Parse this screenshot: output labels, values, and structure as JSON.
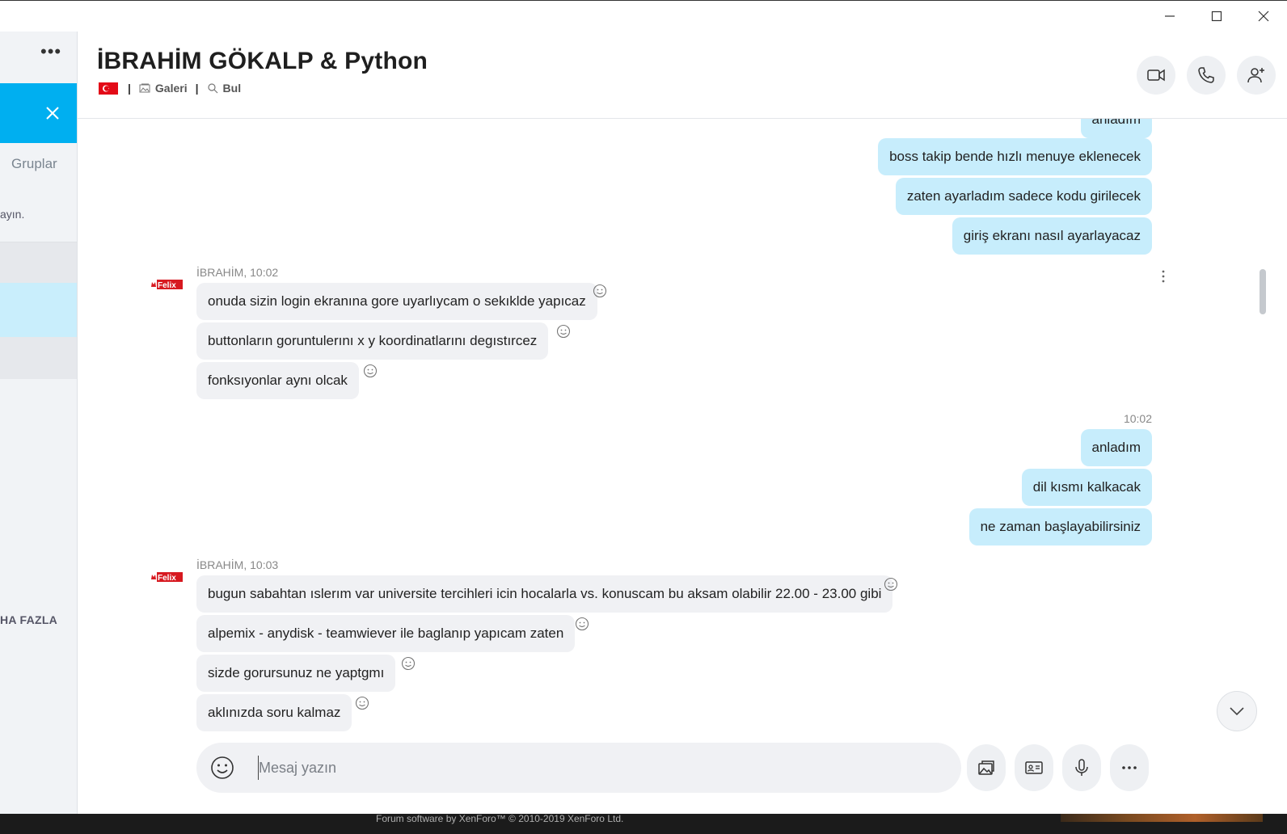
{
  "window": {
    "controls": [
      "minimize",
      "maximize",
      "close"
    ]
  },
  "sidebar": {
    "groups_tab": "Gruplar",
    "hint_fragment": "ayın.",
    "more_label": "HA FAZLA"
  },
  "header": {
    "title": "İBRAHİM GÖKALP & Python",
    "gallery_label": "Galeri",
    "find_label": "Bul",
    "separator": "|"
  },
  "messages": {
    "out_group_1": [
      "anladım",
      "boss takip bende hızlı menuye eklenecek",
      "zaten ayarladım sadece kodu girilecek",
      "giriş ekranı nasıl ayarlayacaz"
    ],
    "in_group_1": {
      "meta": "İBRAHİM, 10:02",
      "items": [
        "onuda sizin login ekranına gore uyarlıycam o sekıklde yapıcaz",
        "buttonların goruntulerını  x y koordinatlarını degıstırcez",
        "fonksıyonlar aynı olcak"
      ]
    },
    "out_group_2": {
      "meta": "10:02",
      "items": [
        "anladım",
        "dil kısmı kalkacak",
        "ne zaman başlayabilirsiniz"
      ]
    },
    "in_group_2": {
      "meta": "İBRAHİM, 10:03",
      "items": [
        " bugun sabahtan ıslerım var universite tercihleri icin hocalarla vs. konuscam bu aksam olabilir 22.00 - 23.00 gibi",
        "alpemix - anydisk - teamwiever ile baglanıp yapıcam zaten",
        "sizde gorursunuz ne yaptgmı",
        "aklınızda soru kalmaz"
      ]
    }
  },
  "avatar_label": "Felix",
  "composer": {
    "placeholder": "Mesaj yazın"
  },
  "footer": {
    "text": "Forum software by XenForo™ © 2010-2019 XenForo Ltd."
  },
  "colors": {
    "accent": "#00aff0",
    "outgoing_bubble": "#c7edfc",
    "incoming_bubble": "#f0f1f4"
  }
}
